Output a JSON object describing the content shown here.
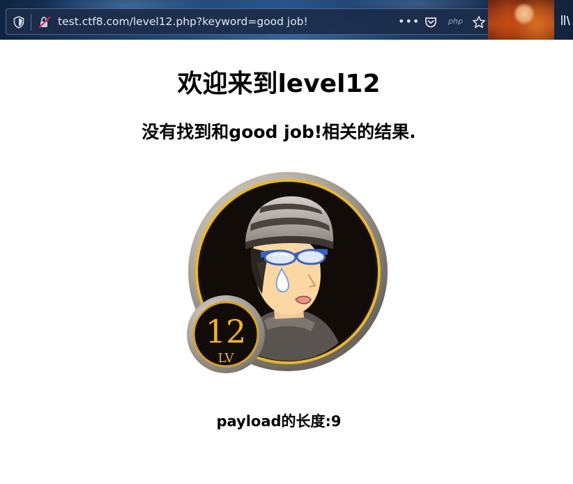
{
  "browser": {
    "url": "test.ctf8.com/level12.php?keyword=good job!",
    "more_icon": "•••",
    "php_badge": "php",
    "icons": [
      "shield-icon",
      "insecure-connection-icon",
      "more-icon",
      "pocket-icon",
      "star-icon",
      "library-icon"
    ]
  },
  "page": {
    "title": "欢迎来到level12",
    "result_text": "没有找到和good job!相关的结果.",
    "badge": {
      "level_number": "12",
      "level_label": "LV"
    },
    "payload_length": "payload的长度:9"
  }
}
